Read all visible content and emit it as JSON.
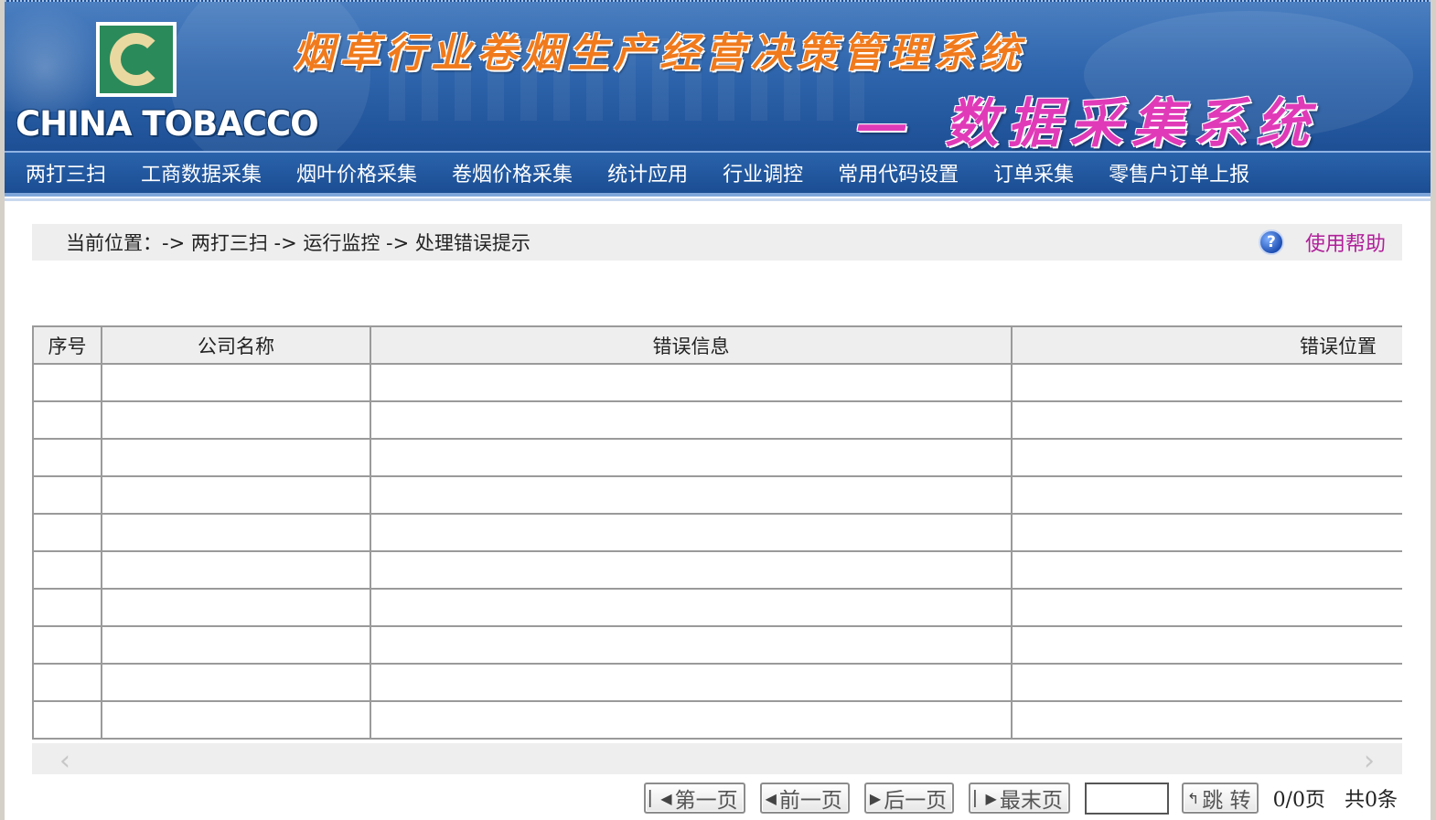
{
  "header": {
    "brand": "CHINA TOBACCO",
    "system_title": "烟草行业卷烟生产经营决策管理系统",
    "sub_title": "— 数据采集系统"
  },
  "nav": {
    "items": [
      {
        "label": "两打三扫"
      },
      {
        "label": "工商数据采集"
      },
      {
        "label": "烟叶价格采集"
      },
      {
        "label": "卷烟价格采集"
      },
      {
        "label": "统计应用"
      },
      {
        "label": "行业调控"
      },
      {
        "label": "常用代码设置"
      },
      {
        "label": "订单采集"
      },
      {
        "label": "零售户订单上报"
      }
    ]
  },
  "breadcrumb": {
    "text": "当前位置：-> 两打三扫 -> 运行监控 -> 处理错误提示",
    "help_label": "使用帮助",
    "help_icon": "question-icon"
  },
  "table": {
    "columns": [
      "序号",
      "公司名称",
      "错误信息",
      "错误位置"
    ],
    "rows": []
  },
  "pager": {
    "first": "第一页",
    "prev": "前一页",
    "next": "后一页",
    "last": "最末页",
    "jump": "跳 转",
    "page_info": "0/0页",
    "total_info": "共0条"
  },
  "colors": {
    "banner_blue": "#2f66ad",
    "nav_blue": "#1b4d93",
    "help_link": "#b0209a",
    "title_orange": "#f07a1c",
    "subtitle_pink": "#e03ab8"
  }
}
